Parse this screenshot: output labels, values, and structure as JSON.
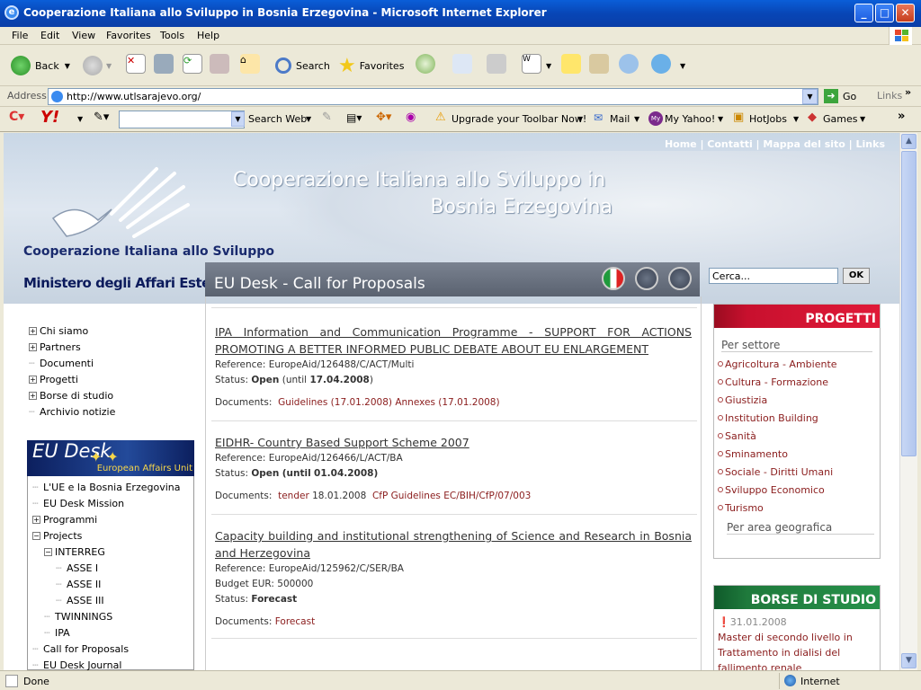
{
  "window": {
    "title": "Cooperazione Italiana allo Sviluppo in Bosnia Erzegovina - Microsoft Internet Explorer"
  },
  "menubar": [
    "File",
    "Edit",
    "View",
    "Favorites",
    "Tools",
    "Help"
  ],
  "toolbar": {
    "back": "Back",
    "search": "Search",
    "favorites": "Favorites"
  },
  "address": {
    "label": "Address",
    "url": "http://www.utlsarajevo.org/",
    "go": "Go",
    "links": "Links"
  },
  "yahoo": {
    "search_web": "Search Web",
    "upgrade": "Upgrade your Toolbar Now!",
    "mail": "Mail",
    "my_yahoo": "My Yahoo!",
    "hotjobs": "HotJobs",
    "games": "Games"
  },
  "site": {
    "toplinks": "Home | Contatti | Mappa del sito | Links",
    "title_line1": "Cooperazione Italiana allo Sviluppo in",
    "title_line2": "Bosnia Erzegovina",
    "logo_top": "Cooperazione Italiana allo Sviluppo",
    "logo_ministry": "Ministero degli Affari Esteri"
  },
  "leftnav": [
    {
      "label": "Chi siamo",
      "bold": true,
      "expander": "+"
    },
    {
      "label": "Partners",
      "bold": true,
      "expander": "+"
    },
    {
      "label": "Documenti",
      "bold": false,
      "expander": ""
    },
    {
      "label": "Progetti",
      "bold": true,
      "expander": "+"
    },
    {
      "label": "Borse di studio",
      "bold": true,
      "expander": "+"
    },
    {
      "label": "Archivio notizie",
      "bold": false,
      "expander": ""
    }
  ],
  "eudesk": {
    "banner_title": "EU Desk",
    "banner_sub": "European Affairs Unit",
    "items": [
      {
        "label": "L'UE e la Bosnia Erzegovina",
        "indent": 0,
        "bold": false,
        "expander": ""
      },
      {
        "label": "EU Desk Mission",
        "indent": 0,
        "bold": false,
        "expander": ""
      },
      {
        "label": "Programmi",
        "indent": 0,
        "bold": true,
        "expander": "+"
      },
      {
        "label": "Projects",
        "indent": 0,
        "bold": true,
        "expander": "−"
      },
      {
        "label": "INTERREG",
        "indent": 1,
        "bold": true,
        "expander": "−"
      },
      {
        "label": "ASSE I",
        "indent": 2,
        "bold": false,
        "expander": ""
      },
      {
        "label": "ASSE II",
        "indent": 2,
        "bold": false,
        "expander": ""
      },
      {
        "label": "ASSE III",
        "indent": 2,
        "bold": false,
        "expander": ""
      },
      {
        "label": "TWINNINGS",
        "indent": 1,
        "bold": false,
        "expander": ""
      },
      {
        "label": "IPA",
        "indent": 1,
        "bold": false,
        "expander": ""
      },
      {
        "label": "Call for Proposals",
        "indent": 0,
        "bold": false,
        "expander": ""
      },
      {
        "label": "EU Desk Journal",
        "indent": 0,
        "bold": false,
        "expander": ""
      }
    ]
  },
  "main": {
    "heading": "EU Desk - Call for Proposals",
    "items": [
      {
        "title": "IPA Information and Communication Programme - SUPPORT FOR ACTIONS PROMOTING A BETTER INFORMED PUBLIC DEBATE ABOUT EU ENLARGEMENT",
        "reference": "Reference: EuropeAid/126488/C/ACT/Multi",
        "status_label": "Status:",
        "status": "Open",
        "status_extra": "(until",
        "status_date": "17.04.2008",
        "status_close": ")",
        "budget": "",
        "docs_label": "Documents:",
        "docs": [
          "Guidelines (17.01.2008)",
          "Annexes (17.01.2008)"
        ]
      },
      {
        "title": "EIDHR- Country Based Support Scheme 2007",
        "reference": "Reference: EuropeAid/126466/L/ACT/BA",
        "status_label": "Status:",
        "status": "Open",
        "status_extra": "(until",
        "status_date": "01.04.2008",
        "status_close": ")",
        "budget": "",
        "docs_label": "Documents:",
        "docs": [
          "tender",
          "18.01.2008",
          "CfP Guidelines EC/BIH/CfP/07/003"
        ]
      },
      {
        "title": "Capacity building and institutional strengthening of Science and Research in Bosnia and Herzegovina",
        "reference": "Reference: EuropeAid/125962/C/SER/BA",
        "status_label": "Status:",
        "status": "Forecast",
        "status_extra": "",
        "status_date": "",
        "status_close": "",
        "budget": "Budget EUR: 500000",
        "docs_label": "Documents:",
        "docs": [
          "Forecast"
        ]
      }
    ]
  },
  "right": {
    "search_value": "Cerca...",
    "ok": "OK",
    "progetti": {
      "heading": "PROGETTI",
      "per_settore": "Per settore",
      "items": [
        "Agricoltura - Ambiente",
        "Cultura - Formazione",
        "Giustizia",
        "Institution Building",
        "Sanità",
        "Sminamento",
        "Sociale - Diritti Umani",
        "Sviluppo Economico",
        "Turismo"
      ],
      "per_area": "Per area geografica"
    },
    "borse": {
      "heading": "BORSE DI STUDIO",
      "date": "31.01.2008",
      "text": "Master di secondo livello in Trattamento in dialisi del fallimento renale"
    }
  },
  "statusbar": {
    "left": "Done",
    "zone": "Internet"
  },
  "colors": {
    "progetti": "#c8102e",
    "borse": "#1f7a3c",
    "link": "#8a1c1c"
  }
}
